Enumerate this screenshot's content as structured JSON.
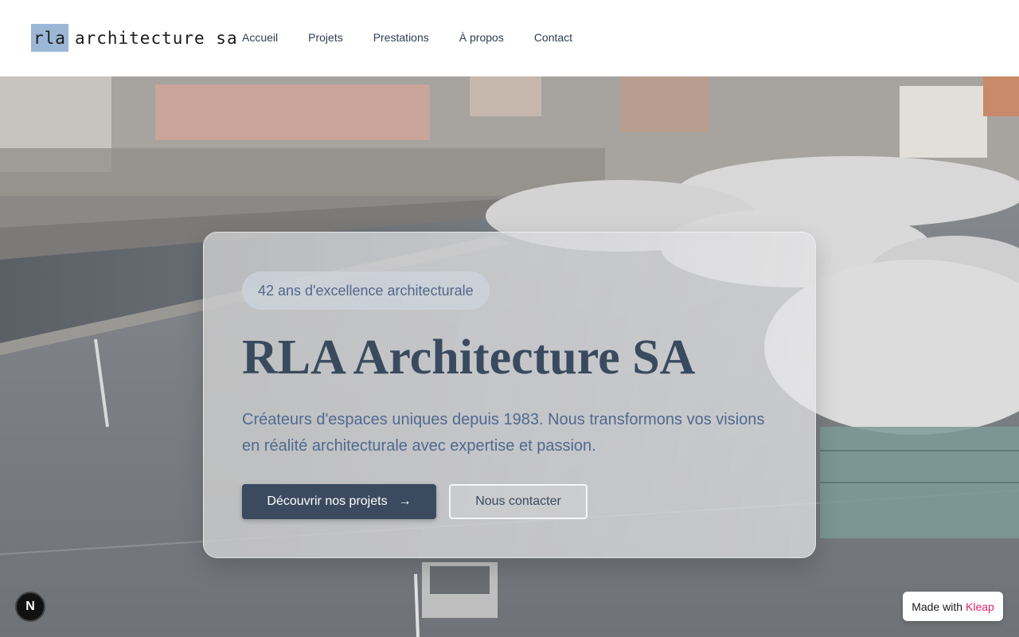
{
  "header": {
    "logo_mark": "rla",
    "logo_text": "architecture sa",
    "nav": [
      "Accueil",
      "Projets",
      "Prestations",
      "À propos",
      "Contact"
    ]
  },
  "hero": {
    "badge": "42 ans d'excellence architecturale",
    "title": "RLA Architecture SA",
    "description": "Créateurs d'espaces uniques depuis 1983. Nous transformons vos visions en réalité architecturale avec expertise et passion.",
    "primary_button": "Découvrir nos projets",
    "secondary_button": "Nous contacter"
  },
  "floating": {
    "n_badge": "N",
    "made_with": "Made with",
    "made_with_brand": "Kleap"
  },
  "icons": {
    "primary_button_icon": "arrow-right-icon"
  },
  "colors": {
    "accent": "#3b4a5f",
    "logo_mark_bg": "#9cb6d6",
    "brand_pink": "#e0206b"
  }
}
